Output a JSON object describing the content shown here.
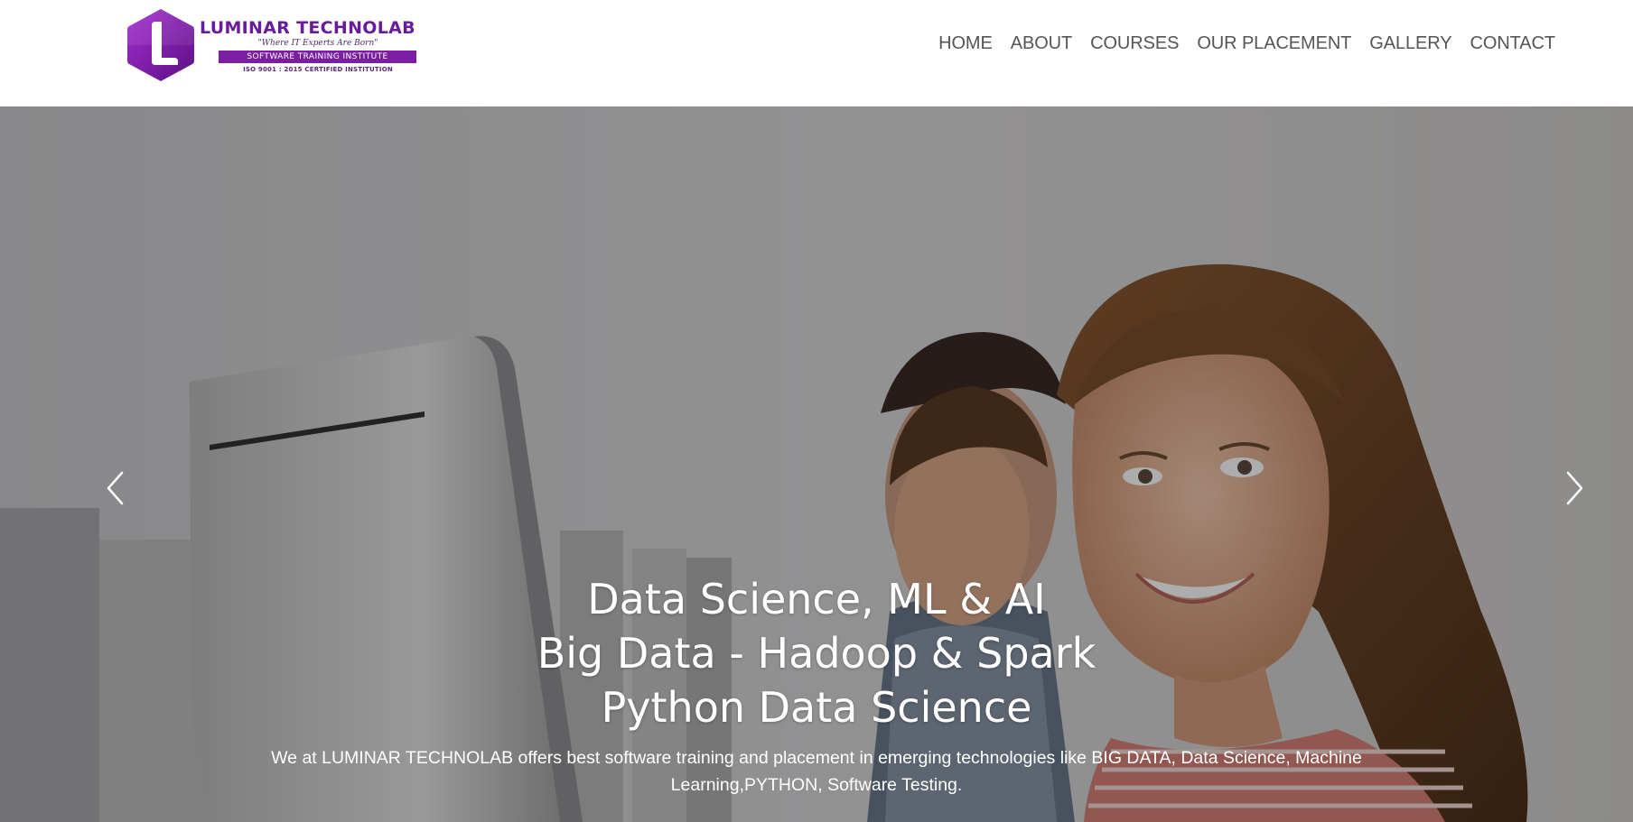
{
  "brand": {
    "name": "LUMINAR TECHNOLAB",
    "tagline": "\"Where IT Experts Are Born\"",
    "band_text": "SOFTWARE TRAINING INSTITUTE",
    "certification": "ISO 9001 : 2015 CERTIFIED INSTITUTION",
    "logo_letter": "L",
    "colors": {
      "primary": "#6a1b9a",
      "accent": "#9c27b0"
    }
  },
  "nav": {
    "items": [
      {
        "label": "HOME"
      },
      {
        "label": "ABOUT"
      },
      {
        "label": "COURSES"
      },
      {
        "label": "OUR PLACEMENT"
      },
      {
        "label": "GALLERY"
      },
      {
        "label": "CONTACT"
      }
    ]
  },
  "hero": {
    "headlines": [
      "Data Science, ML & AI",
      "Big Data - Hadoop & Spark",
      "Python Data Science"
    ],
    "description": "We at LUMINAR TECHNOLAB offers best software training and placement in emerging technologies like BIG DATA, Data Science, Machine Learning,PYTHON, Software Testing.",
    "prev_icon": "chevron-left-icon",
    "next_icon": "chevron-right-icon"
  }
}
